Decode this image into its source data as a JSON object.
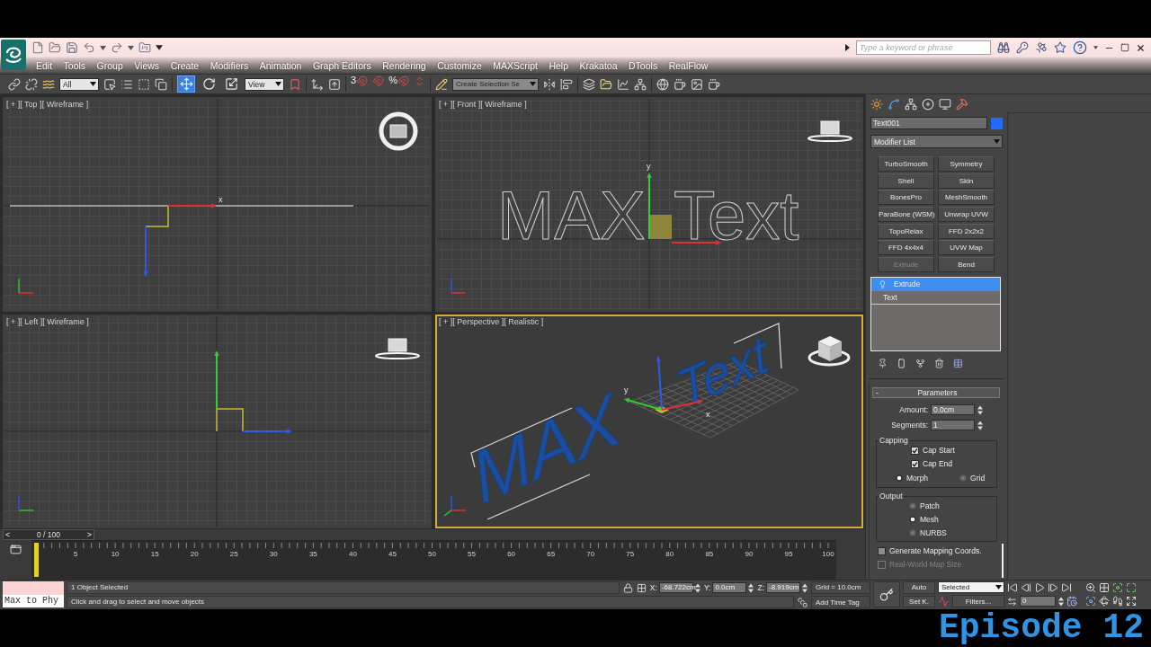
{
  "title_bar": {
    "search": {
      "placeholder": "Type a keyword or phrase"
    }
  },
  "menu": [
    "Edit",
    "Tools",
    "Group",
    "Views",
    "Create",
    "Modifiers",
    "Animation",
    "Graph Editors",
    "Rendering",
    "Customize",
    "MAXScript",
    "Help",
    "Krakatoa",
    "DTools",
    "RealFlow"
  ],
  "toolbar": {
    "selection_filter": "All",
    "transform_tools": [
      {
        "kind": "move",
        "selected": true
      },
      {
        "kind": "rotate",
        "selected": false
      },
      {
        "kind": "scale",
        "selected": false
      }
    ],
    "coordinate_system": "View",
    "snap_toggles": [
      {
        "kind": "snap",
        "label": "3"
      },
      {
        "kind": "angle"
      },
      {
        "kind": "percent",
        "label": "%"
      },
      {
        "kind": "spinner"
      }
    ],
    "named_selection": "Create Selection Se"
  },
  "viewports": [
    {
      "kind": "top",
      "labels": [
        "[ + ]",
        "[ Top ]",
        "[ Wireframe ]"
      ],
      "active": false,
      "axis_labels": [
        "x"
      ]
    },
    {
      "kind": "front",
      "labels": [
        "[ + ]",
        "[ Front ]",
        "[ Wireframe ]"
      ],
      "active": false,
      "object_words": [
        "MAX",
        "Text"
      ],
      "axis_labels": [
        "y"
      ]
    },
    {
      "kind": "left",
      "labels": [
        "[ + ]",
        "[ Left ]",
        "[ Wireframe ]"
      ],
      "active": false
    },
    {
      "kind": "perspective",
      "labels": [
        "[ + ]",
        "[ Perspective ]",
        "[ Realistic ]"
      ],
      "active": true,
      "object_words": [
        "MAX",
        "Text"
      ],
      "axis_labels": [
        "y",
        "x"
      ]
    }
  ],
  "command_panel": {
    "object": {
      "name": "Text001",
      "color": "#1e6bff"
    },
    "modifier_list": "Modifier List",
    "modifier_buttons": [
      {
        "label": "TurboSmooth",
        "disabled": false
      },
      {
        "label": "Symmetry",
        "disabled": false
      },
      {
        "label": "Shell",
        "disabled": false
      },
      {
        "label": "Skin",
        "disabled": false
      },
      {
        "label": "BonesPro",
        "disabled": false
      },
      {
        "label": "MeshSmooth",
        "disabled": false
      },
      {
        "label": "ParaBone (WSM)",
        "disabled": false
      },
      {
        "label": "Unwrap UVW",
        "disabled": false
      },
      {
        "label": "TopoRelax",
        "disabled": false
      },
      {
        "label": "FFD 2x2x2",
        "disabled": false
      },
      {
        "label": "FFD 4x4x4",
        "disabled": false
      },
      {
        "label": "UVW Map",
        "disabled": false
      },
      {
        "label": "Extrude",
        "disabled": true
      },
      {
        "label": "Bend",
        "disabled": false
      }
    ],
    "stack": [
      {
        "kind": "modifier",
        "label": "Extrude",
        "selected": true
      },
      {
        "kind": "base",
        "label": "Text",
        "selected": false
      }
    ],
    "rollout": {
      "title": "Parameters",
      "toggle": "-",
      "spinners": [
        {
          "label": "Amount:",
          "value": "0.0cm"
        },
        {
          "label": "Segments:",
          "value": "1"
        }
      ],
      "groups": [
        {
          "title": "Capping",
          "items": [
            {
              "kind": "checkbox",
              "label": "Cap Start",
              "checked": true
            },
            {
              "kind": "checkbox",
              "label": "Cap End",
              "checked": true
            },
            {
              "kind": "radio_row",
              "options": [
                {
                  "label": "Morph",
                  "selected": true
                },
                {
                  "label": "Grid",
                  "selected": false
                }
              ]
            }
          ]
        },
        {
          "title": "Output",
          "items": [
            {
              "kind": "radio",
              "label": "Patch",
              "selected": false
            },
            {
              "kind": "radio",
              "label": "Mesh",
              "selected": true
            },
            {
              "kind": "radio",
              "label": "NURBS",
              "selected": false
            }
          ]
        }
      ],
      "options": [
        {
          "label": "Generate Mapping Coords.",
          "checked": false,
          "disabled": false
        },
        {
          "label": "Real-World Map Size",
          "checked": false,
          "disabled": true
        }
      ]
    }
  },
  "timeline": {
    "slider": {
      "prev": "<",
      "label": "0 / 100",
      "next": ">",
      "level": 0
    },
    "ticks": [
      "5",
      "10",
      "15",
      "20",
      "25",
      "30",
      "35",
      "40",
      "45",
      "50",
      "55",
      "60",
      "65",
      "70",
      "75",
      "80",
      "85",
      "90",
      "95",
      "100"
    ]
  },
  "status_bar": {
    "listener": {
      "input": "Max to Phy"
    },
    "prompt": "1 Object Selected",
    "hint": "Click and drag to select and move objects",
    "coordinates": [
      {
        "axis": "X:",
        "value": "-68.722cm"
      },
      {
        "axis": "Y:",
        "value": "0.0cm"
      },
      {
        "axis": "Z:",
        "value": "-8.919cm"
      }
    ],
    "grid": "Grid = 10.0cm",
    "time_tag": "Add Time Tag",
    "auto_key": "Auto",
    "set_key": "Set K.",
    "key_filter": "Selected",
    "filters": "Filters...",
    "frame": "0"
  },
  "caption": "Episode 12"
}
